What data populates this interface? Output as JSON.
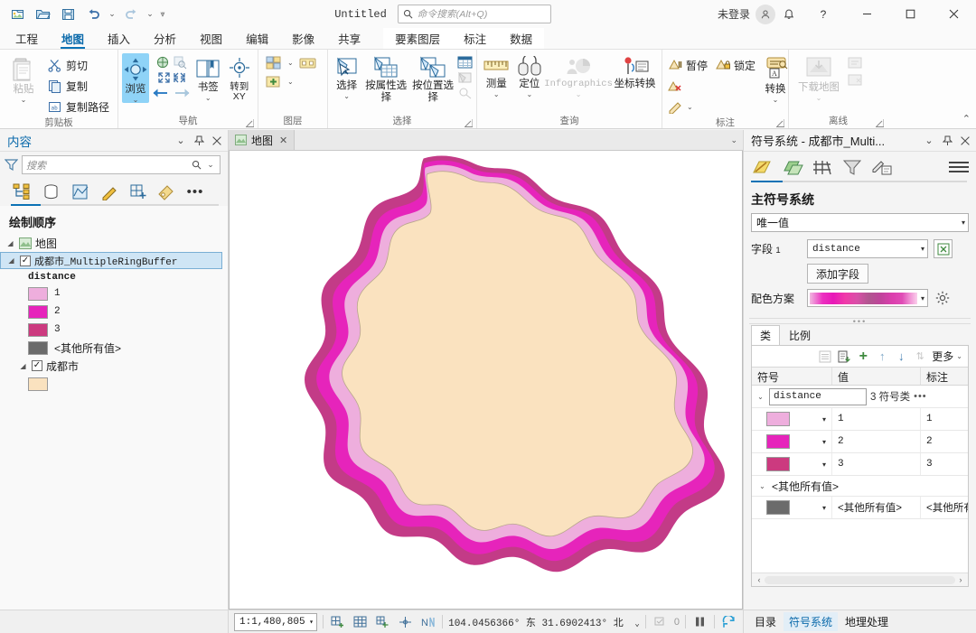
{
  "app": {
    "document_title": "Untitled",
    "search_placeholder": "命令搜索(Alt+Q)",
    "account_status": "未登录"
  },
  "quick_access": [
    {
      "name": "new-project-icon",
      "tip": "新建"
    },
    {
      "name": "open-project-icon",
      "tip": "打开"
    },
    {
      "name": "save-project-icon",
      "tip": "保存"
    },
    {
      "name": "undo-icon",
      "tip": "撤销"
    },
    {
      "name": "redo-icon",
      "tip": "重做"
    },
    {
      "name": "customize-qat-icon",
      "tip": "自定义快速访问工具栏"
    }
  ],
  "window_buttons": {
    "minimize": "—",
    "maximize": "▢",
    "close": "✕",
    "help": "?"
  },
  "ribbon": {
    "tabs": [
      {
        "label": "工程",
        "active": false
      },
      {
        "label": "地图",
        "active": true
      },
      {
        "label": "插入",
        "active": false
      },
      {
        "label": "分析",
        "active": false
      },
      {
        "label": "视图",
        "active": false
      },
      {
        "label": "编辑",
        "active": false
      },
      {
        "label": "影像",
        "active": false
      },
      {
        "label": "共享",
        "active": false
      }
    ],
    "contextual_tabs": [
      {
        "label": "要素图层",
        "active": true
      },
      {
        "label": "标注",
        "active": false
      },
      {
        "label": "数据",
        "active": false
      }
    ],
    "groups": [
      {
        "label": "剪贴板",
        "big": [
          {
            "label": "粘贴",
            "icon": "paste-icon",
            "disabled": true,
            "dropdown": true
          }
        ],
        "small": [
          {
            "label": "剪切",
            "icon": "cut-icon"
          },
          {
            "label": "复制",
            "icon": "copy-icon"
          },
          {
            "label": "复制路径",
            "icon": "copy-path-icon"
          }
        ],
        "has_dialog_launcher": false
      },
      {
        "label": "导航",
        "big": [
          {
            "label": "浏览",
            "icon": "explore-icon",
            "selected": true,
            "dropdown": true
          },
          {
            "label": "书签",
            "icon": "bookmarks-icon",
            "dropdown": true
          },
          {
            "label": "转到 XY",
            "icon": "go-to-xy-icon"
          }
        ],
        "has_dialog_launcher": true
      },
      {
        "label": "图层",
        "big": [],
        "has_dialog_launcher": false
      },
      {
        "label": "选择",
        "big": [
          {
            "label": "选择",
            "icon": "select-icon",
            "dropdown": true
          },
          {
            "label": "按属性选择",
            "icon": "select-by-attributes-icon"
          },
          {
            "label": "按位置选择",
            "icon": "select-by-location-icon"
          }
        ],
        "has_dialog_launcher": true
      },
      {
        "label": "查询",
        "big": [
          {
            "label": "测量",
            "icon": "measure-icon",
            "dropdown": true
          },
          {
            "label": "定位",
            "icon": "locate-icon",
            "dropdown": true
          },
          {
            "label": "Infographics",
            "icon": "infographics-icon",
            "disabled": true,
            "dropdown": true
          },
          {
            "label": "坐标转换",
            "icon": "coordinate-conversion-icon"
          }
        ],
        "has_dialog_launcher": false
      },
      {
        "label": "标注",
        "big": [
          {
            "label": "转换",
            "icon": "convert-labels-icon",
            "dropdown": true
          }
        ],
        "small": [
          {
            "label": "暂停",
            "icon": "pause-labels-icon"
          },
          {
            "label": "锁定",
            "icon": "lock-labels-icon"
          }
        ],
        "has_dialog_launcher": true
      },
      {
        "label": "离线",
        "big": [
          {
            "label": "下载地图",
            "icon": "download-map-icon",
            "disabled": true,
            "dropdown": true
          }
        ],
        "has_dialog_launcher": true
      }
    ]
  },
  "contents": {
    "title": "内容",
    "search_placeholder": "搜索",
    "tabs": [
      {
        "name": "list-by-drawing-order-icon",
        "active": true
      },
      {
        "name": "list-by-data-source-icon",
        "active": false
      },
      {
        "name": "list-by-selection-icon",
        "active": false
      },
      {
        "name": "list-by-editing-icon",
        "active": false
      },
      {
        "name": "list-by-snapping-icon",
        "active": false
      },
      {
        "name": "list-by-labeling-icon",
        "active": false
      }
    ],
    "section_label": "绘制顺序",
    "map_node": "地图",
    "layers": [
      {
        "name": "成都市_MultipleRingBuffer",
        "checked": true,
        "selected": true,
        "field": "distance",
        "legend": [
          {
            "label": "1",
            "color": "#eeaedd"
          },
          {
            "label": "2",
            "color": "#e624bb"
          },
          {
            "label": "3",
            "color": "#cc3a7f"
          },
          {
            "label": "<其他所有值>",
            "color": "#6b6b6b"
          }
        ]
      },
      {
        "name": "成都市",
        "checked": true,
        "selected": false,
        "legend": [
          {
            "label": "",
            "color": "#fae2bf"
          }
        ]
      }
    ]
  },
  "map": {
    "tab_label": "地图",
    "close_glyph": "✕",
    "background": "#ffffff",
    "fill_color": "#fae2bf",
    "ring_colors": [
      "#eeaedd",
      "#e624bb",
      "#c33b87"
    ]
  },
  "symbology": {
    "title": "符号系统 - 成都市_Multi...",
    "tabs": [
      {
        "name": "primary-symbology-icon",
        "active": true
      },
      {
        "name": "vary-symbology-by-attribute-icon",
        "active": false
      },
      {
        "name": "advanced-symbol-options-icon",
        "active": false
      },
      {
        "name": "display-filters-icon",
        "active": false
      },
      {
        "name": "symbol-layer-drawing-icon",
        "active": false
      }
    ],
    "primary_heading": "主符号系统",
    "primary_value": "唯一值",
    "field_label": "字段",
    "field_index": "1",
    "field_value": "distance",
    "expression_button": "expression-builder-icon",
    "add_field_label": "添加字段",
    "color_scheme_label": "配色方案",
    "color_scheme_stops": [
      "#f0b9e0",
      "#ec2fc0",
      "#e818b8",
      "#f03aa9",
      "#d94fa8",
      "#b0568f",
      "#c0439b",
      "#dc3fae",
      "#e04cb6",
      "#f29ad8",
      "#fbd0ec"
    ],
    "class_tabs": [
      {
        "label": "类",
        "active": true
      },
      {
        "label": "比例",
        "active": false
      }
    ],
    "table_toolbar": {
      "more_label": "更多",
      "buttons": [
        "list-icon",
        "add-all-values-icon",
        "add-value-icon",
        "move-up-icon",
        "move-down-icon",
        "sort-icon"
      ]
    },
    "table_headers": [
      "符号",
      "值",
      "标注"
    ],
    "group_row": {
      "field_name": "distance",
      "class_count_label": "3 符号类",
      "options_glyph": "•••"
    },
    "rows": [
      {
        "color": "#eeaedd",
        "value": "1",
        "label": "1"
      },
      {
        "color": "#e624bb",
        "value": "2",
        "label": "2"
      },
      {
        "color": "#cc3a7f",
        "value": "3",
        "label": "3"
      }
    ],
    "other_group_label": "<其他所有值>",
    "other_row": {
      "color": "#6b6b6b",
      "value": "<其他所有值>",
      "label": "<其他所有"
    }
  },
  "statusbar": {
    "scale": "1:1,480,805",
    "coordinates": "104.0456366° 东  31.6902413° 北",
    "selected_count": "0",
    "tools": [
      "add-graphics-icon",
      "grid-icon",
      "snapping-icon",
      "vertex-icon",
      "north-icon"
    ],
    "pause-button": "⏸",
    "refresh-button": "refresh-icon"
  },
  "dock_tabs": [
    {
      "label": "目录",
      "active": false
    },
    {
      "label": "符号系统",
      "active": true
    },
    {
      "label": "地理处理",
      "active": false
    }
  ]
}
